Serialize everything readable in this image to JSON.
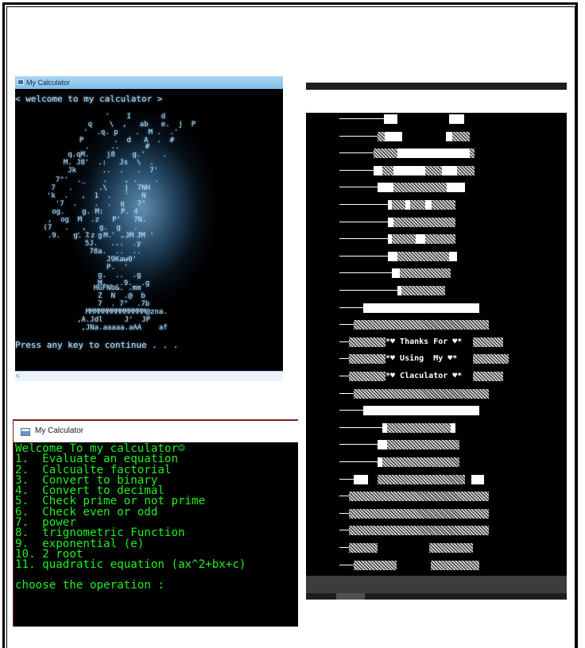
{
  "window1": {
    "title": "My Calculator",
    "welcome_text": "< welcome to my calculator >",
    "press_text": "Press any key to continue . . .",
    "art": [
      "        '    I       d     \n    q    \\  ,   ab   e.  j  P\n   '  .q. p    .  M .  .'\n  P       .  d   A  .  #",
      "       .     ..      #\n   q.qM.    j8    g.'    .\n  M. J8'  .:   Js  \\  .\n   Jk      ..  .   .  7'",
      "  7\"'  ._    .    , .    .\n 7   .      .\\    j  7NH\n'k  .   ,  1  .   '   N\n  '7  .    .  .  q   7\"",
      "   og.    g. M:    P. 4\n  ,  og  M  .z   P'   7N.\n (7   .   ,   g.  g   .   \n  .9.   g. .z  M.  .JM '",
      "     ' 7  g  ' .   JM '\n       5J.   ...  .y\n        78a.  ..  ..",
      "            J9Kaw0'\n            P.  '\n          g.  ..  .g\n          M.   .9.  .g",
      "         HGFNb&. .mm\n          Z  N  .@  b\n          7  . 7\"  .7b",
      "         MMMMMMMMMMMMMM@zna.\n       ,A.Jdl     J'  JP\n        ,JNa.aaaaa.aAA    af"
    ]
  },
  "window2": {
    "title": "My Calculator",
    "lines": [
      "Welcome To my calculator☺",
      "1.  Evaluate an equation",
      "2.  Calcualte factorial",
      "3.  Convert to binary",
      "4.  Convert to decimal",
      "5.  Check prime or not prime",
      "6.  Check even or odd",
      "7.  power",
      "8.  trignometric Function",
      "9.  exponential (e)",
      "10. 2 root",
      "11. quadratic equation (ax^2+bx+c)"
    ],
    "prompt": "choose the operation :"
  },
  "window3": {
    "messages": [
      "Thanks For",
      "Using  My",
      "Claculator"
    ],
    "heart_left": "*♥",
    "heart_right": "♥*"
  }
}
